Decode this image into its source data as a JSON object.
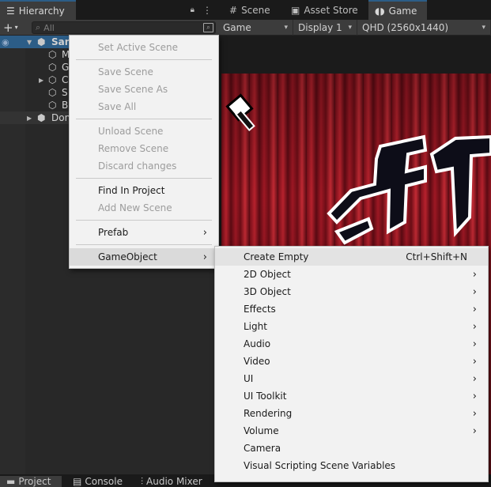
{
  "hierarchy": {
    "tab_label": "Hierarchy",
    "search_placeholder": "All",
    "rows": [
      {
        "label": "San",
        "icon": "unity-scene-icon"
      },
      {
        "label": "M",
        "icon": "cube-icon"
      },
      {
        "label": "G",
        "icon": "cube-icon"
      },
      {
        "label": "C",
        "icon": "cube-icon"
      },
      {
        "label": "S",
        "icon": "cube-icon"
      },
      {
        "label": "B",
        "icon": "cube-icon"
      },
      {
        "label": "Don",
        "icon": "unity-scene-icon"
      }
    ]
  },
  "game_window": {
    "tabs": [
      {
        "label": "Scene",
        "icon": "grid-icon"
      },
      {
        "label": "Asset Store",
        "icon": "shopping-bag-icon"
      },
      {
        "label": "Game",
        "icon": "gamepad-icon"
      }
    ],
    "toolbar": {
      "view_select": "Game",
      "display_select": "Display 1",
      "resolution_select": "QHD (2560x1440)"
    }
  },
  "bottom_tabs": [
    {
      "label": "Project",
      "icon": "folder-icon"
    },
    {
      "label": "Console",
      "icon": "console-icon"
    },
    {
      "label": "Audio Mixer",
      "icon": "mixer-icon"
    }
  ],
  "scene_context_menu": {
    "items": [
      {
        "label": "Set Active Scene",
        "disabled": true
      },
      {
        "label": "Save Scene",
        "disabled": true
      },
      {
        "label": "Save Scene As",
        "disabled": true
      },
      {
        "label": "Save All",
        "disabled": true
      },
      {
        "label": "Unload Scene",
        "disabled": true
      },
      {
        "label": "Remove Scene",
        "disabled": true
      },
      {
        "label": "Discard changes",
        "disabled": true
      },
      {
        "label": "Find In Project",
        "disabled": false
      },
      {
        "label": "Add New Scene",
        "disabled": true
      },
      {
        "label": "Prefab",
        "disabled": false,
        "submenu": true
      },
      {
        "label": "GameObject",
        "disabled": false,
        "submenu": true,
        "highlighted": true
      }
    ]
  },
  "gameobject_submenu": {
    "items": [
      {
        "label": "Create Empty",
        "shortcut": "Ctrl+Shift+N",
        "highlighted": true
      },
      {
        "label": "2D Object",
        "submenu": true
      },
      {
        "label": "3D Object",
        "submenu": true
      },
      {
        "label": "Effects",
        "submenu": true
      },
      {
        "label": "Light",
        "submenu": true
      },
      {
        "label": "Audio",
        "submenu": true
      },
      {
        "label": "Video",
        "submenu": true
      },
      {
        "label": "UI",
        "submenu": true
      },
      {
        "label": "UI Toolkit",
        "submenu": true
      },
      {
        "label": "Rendering",
        "submenu": true
      },
      {
        "label": "Volume",
        "submenu": true
      },
      {
        "label": "Camera",
        "submenu": false
      },
      {
        "label": "Visual Scripting Scene Variables",
        "submenu": false
      }
    ]
  },
  "glyphs": {
    "plus": "+",
    "caret_down": "▾",
    "arrow_right": "›",
    "arrow_expand": "▶",
    "arrow_collapse": "▼",
    "lock": "🔒",
    "more": "⋮",
    "search": "⌕",
    "eye": "◉"
  }
}
